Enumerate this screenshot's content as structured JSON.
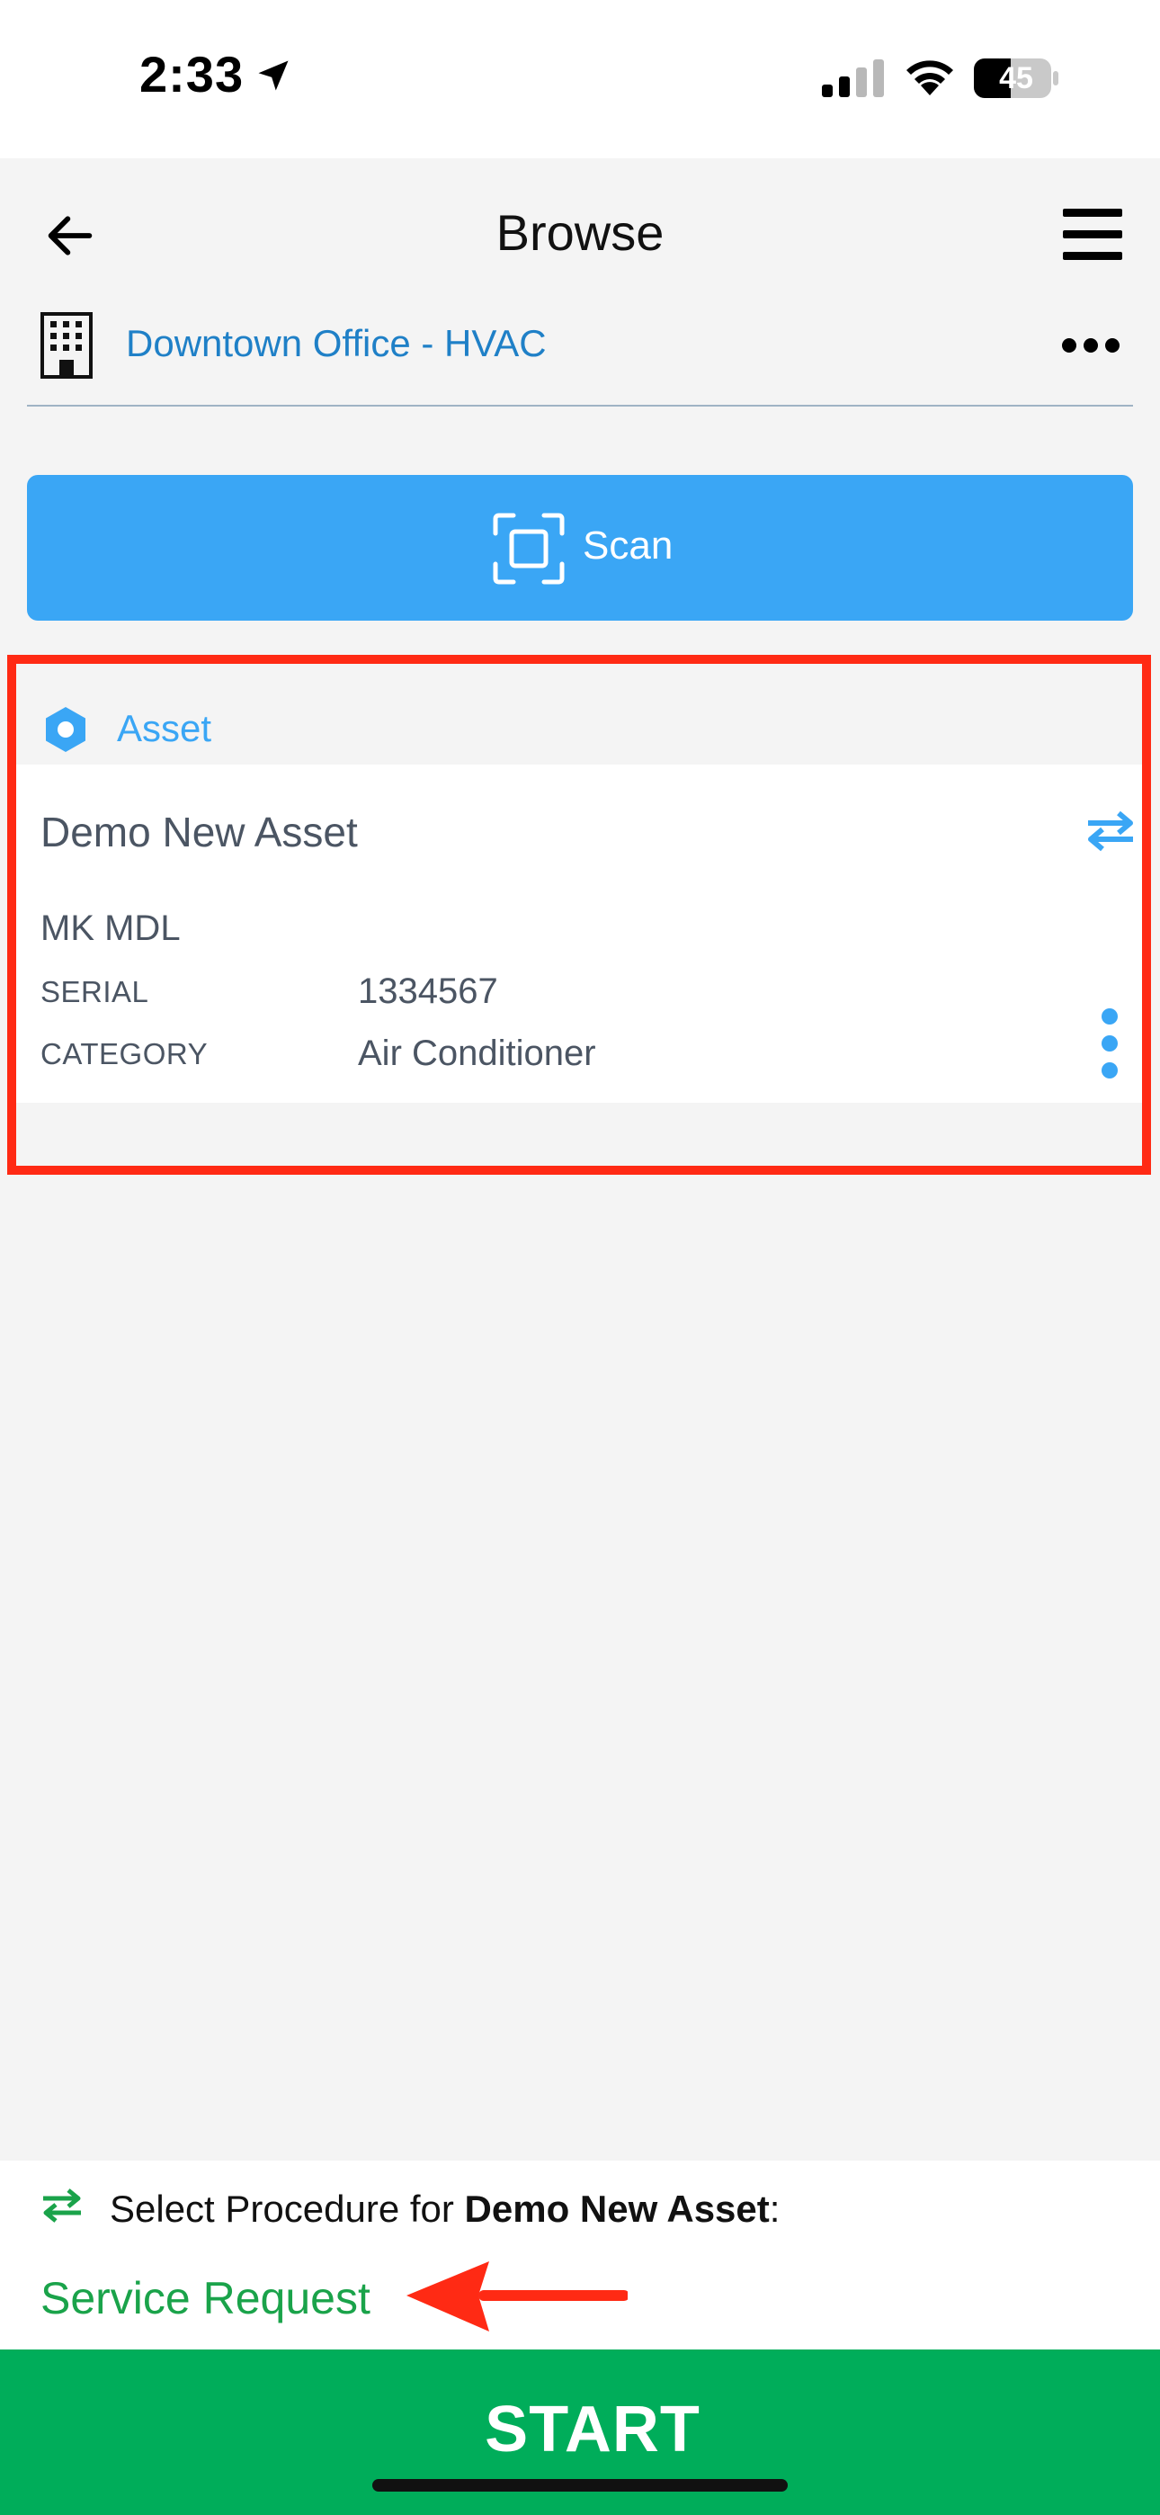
{
  "status_bar": {
    "time": "2:33",
    "battery_level": "45",
    "icons": [
      "location-arrow-icon",
      "cellular-signal-icon",
      "wifi-icon",
      "battery-icon"
    ]
  },
  "nav": {
    "title": "Browse",
    "back_icon": "arrow-left-icon",
    "menu_icon": "hamburger-menu-icon"
  },
  "site": {
    "name": "Downtown Office - HVAC",
    "icon": "building-icon",
    "more_icon": "more-horizontal-icon"
  },
  "scan": {
    "label": "Scan",
    "icon": "scan-frame-icon"
  },
  "asset": {
    "type_label": "Asset",
    "type_icon": "hexagon-icon",
    "name": "Demo New Asset",
    "make_model": "MK MDL",
    "fields": [
      {
        "label": "SERIAL",
        "value": "1334567"
      },
      {
        "label": "CATEGORY",
        "value": "Air Conditioner"
      }
    ],
    "swap_icon": "swap-arrows-icon",
    "options_icon": "more-vertical-icon"
  },
  "procedure": {
    "prompt_prefix": "Select Procedure for ",
    "asset_name": "Demo New Asset",
    "prompt_suffix": ":",
    "selected": "Service Request"
  },
  "start_label": "START",
  "colors": {
    "accent_blue": "#3aa6f5",
    "link_blue": "#1f80c7",
    "start_green": "#00ad5a",
    "procedure_green": "#1aa34a",
    "annotation_red": "#ff2a14",
    "background": "#f4f4f4"
  }
}
